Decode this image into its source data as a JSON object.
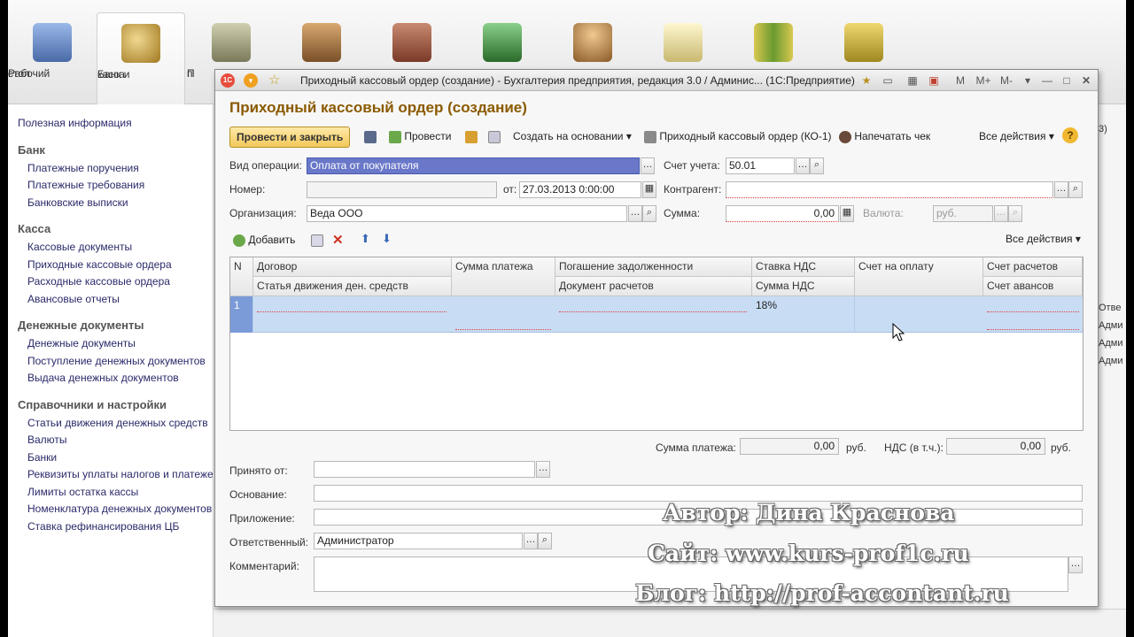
{
  "sections": [
    {
      "label1": "Рабочий",
      "label2": "стол",
      "icon": "desktop-icon",
      "color": "#6a8fc8"
    },
    {
      "label1": "Банк и",
      "label2": "касса",
      "icon": "coins-icon",
      "color": "#c8a040"
    },
    {
      "label1": "П",
      "label2": "п",
      "icon": "truck-icon",
      "color": "#8a8a6a"
    },
    {
      "label1": "",
      "label2": "",
      "icon": "warehouse-icon",
      "color": "#a07040"
    },
    {
      "label1": "",
      "label2": "",
      "icon": "toolbox-icon",
      "color": "#9a5a40"
    },
    {
      "label1": "",
      "label2": "",
      "icon": "factory-icon",
      "color": "#3a8a3a"
    },
    {
      "label1": "",
      "label2": "",
      "icon": "employee-icon",
      "color": "#c88a40"
    },
    {
      "label1": "",
      "label2": "",
      "icon": "documents-icon",
      "color": "#d8c880"
    },
    {
      "label1": "",
      "label2": "",
      "icon": "binders-icon",
      "color": "#7a9a40"
    },
    {
      "label1": "",
      "label2": "",
      "icon": "database-icon",
      "color": "#c8b040"
    }
  ],
  "nav": {
    "top_item": "Полезная информация",
    "groups": [
      {
        "title": "Банк",
        "items": [
          "Платежные поручения",
          "Платежные требования",
          "Банковские выписки"
        ]
      },
      {
        "title": "Касса",
        "items": [
          "Кассовые документы",
          "Приходные кассовые ордера",
          "Расходные кассовые ордера",
          "Авансовые отчеты"
        ]
      },
      {
        "title": "Денежные документы",
        "items": [
          "Денежные документы",
          "Поступление денежных документов",
          "Выдача денежных документов"
        ]
      },
      {
        "title": "Справочники и настройки",
        "items": [
          "Статьи движения денежных средств",
          "Валюты",
          "Банки",
          "Реквизиты уплаты налогов и платежей",
          "Лимиты остатка кассы",
          "Номенклатура денежных документов",
          "Ставка рефинансирования ЦБ"
        ]
      }
    ]
  },
  "bg_right": {
    "t1": "3)",
    "t2": "Отве",
    "t3": "Адми",
    "t4": "Адми",
    "t5": "Адми"
  },
  "window": {
    "title": "Приходный кассовый ордер (создание) - Бухгалтерия предприятия, редакция 3.0 / Админис...  (1С:Предприятие)",
    "logo": "1С",
    "tb_icons": [
      "star-icon",
      "page-icon",
      "calculator-icon",
      "calendar-icon",
      "M",
      "M+",
      "M-"
    ]
  },
  "doc": {
    "title": "Приходный кассовый ордер (создание)",
    "commands": {
      "post_close": "Провести и закрыть",
      "post": "Провести",
      "create_based": "Создать на основании",
      "print_ko1": "Приходный кассовый ордер (КО-1)",
      "print_check": "Напечатать чек",
      "all_actions": "Все действия",
      "help": "?"
    },
    "fields": {
      "op_type_label": "Вид операции:",
      "op_type_value": "Оплата от покупателя",
      "account_label": "Счет учета:",
      "account_value": "50.01",
      "number_label": "Номер:",
      "number_value": "",
      "date_label": "от:",
      "date_value": "27.03.2013  0:00:00",
      "counterparty_label": "Контрагент:",
      "counterparty_value": "",
      "org_label": "Организация:",
      "org_value": "Веда ООО",
      "sum_label": "Сумма:",
      "sum_value": "0,00",
      "currency_label": "Валюта:",
      "currency_value": "руб."
    },
    "table": {
      "add_label": "Добавить",
      "all_actions": "Все действия",
      "headers_row1": [
        "N",
        "Договор",
        "Сумма платежа",
        "Погашение задолженности",
        "Ставка НДС",
        "Счет на оплату",
        "Счет расчетов"
      ],
      "headers_row2": [
        "Статья движения ден. средств",
        "Документ расчетов",
        "Сумма НДС",
        "Счет авансов"
      ],
      "row": {
        "n": "1",
        "vat_rate": "18%"
      }
    },
    "totals": {
      "pay_sum_label": "Сумма платежа:",
      "pay_sum_value": "0,00",
      "cur1": "руб.",
      "vat_label": "НДС (в т.ч.):",
      "vat_value": "0,00",
      "cur2": "руб."
    },
    "bottom": {
      "received_label": "Принято от:",
      "received_value": "",
      "basis_label": "Основание:",
      "basis_value": "",
      "appendix_label": "Приложение:",
      "appendix_value": "",
      "responsible_label": "Ответственный:",
      "responsible_value": "Администратор",
      "comment_label": "Комментарий:",
      "comment_value": ""
    }
  },
  "watermark": {
    "author": "Автор: Дина Краснова",
    "site": "Сайт: www.kurs-prof1c.ru",
    "blog": "Блог: http://prof-accontant.ru"
  }
}
